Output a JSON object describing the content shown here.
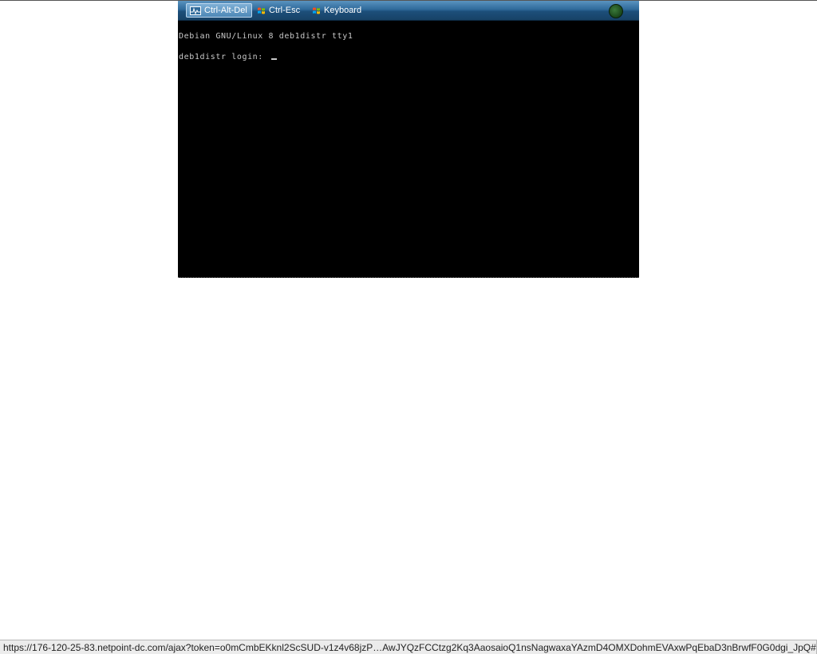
{
  "toolbar": {
    "buttons": [
      {
        "label": "Ctrl-Alt-Del",
        "icon": "monitor-icon",
        "active": true
      },
      {
        "label": "Ctrl-Esc",
        "icon": "windows-logo-icon",
        "active": false
      },
      {
        "label": "Keyboard",
        "icon": "windows-logo-icon",
        "active": false
      }
    ],
    "status_icon": "connection-status-icon",
    "status_color": "#2f6b2f"
  },
  "terminal": {
    "lines": [
      "Debian GNU/Linux 8 deb1distr tty1",
      "deb1distr login: "
    ],
    "background": "#000000",
    "foreground": "#c8c8c8"
  },
  "statusbar": {
    "url": "https://176-120-25-83.netpoint-dc.com/ajax?token=o0mCmbEKknl2ScSUD-v1z4v68jzP…AwJYQzFCCtzg2Kq3AaosaioQ1nsNagwaxaYAzmD4OMXDohmEVAxwPqEbaD3nBrwfF0G0dgi_JpQ#"
  }
}
